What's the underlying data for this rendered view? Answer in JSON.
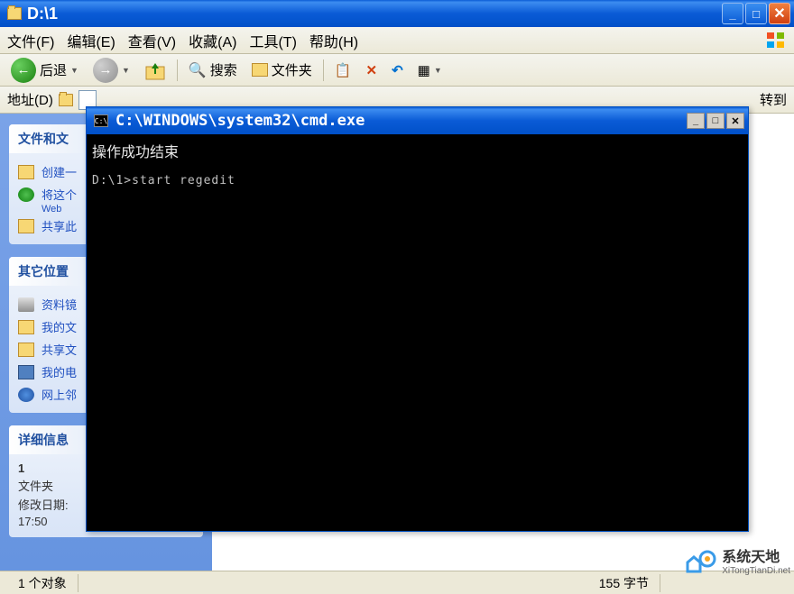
{
  "explorer": {
    "title": "D:\\1",
    "menu": {
      "file": "文件(F)",
      "edit": "编辑(E)",
      "view": "查看(V)",
      "favorites": "收藏(A)",
      "tools": "工具(T)",
      "help": "帮助(H)"
    },
    "toolbar": {
      "back": "后退",
      "search": "搜索",
      "folders": "文件夹"
    },
    "address": {
      "label": "地址(D)",
      "goto": "转到"
    },
    "sidebar": {
      "panel1": {
        "title": "文件和文",
        "items": [
          "创建一",
          "将这个",
          "共享此"
        ],
        "subweb": "Web"
      },
      "panel2": {
        "title": "其它位置",
        "items": [
          "资料镜",
          "我的文",
          "共享文",
          "我的电",
          "网上邻"
        ]
      },
      "panel3": {
        "title": "详细信息",
        "name": "1",
        "type": "文件夹",
        "modified_label": "修改日期:",
        "modified_time": "17:50"
      }
    },
    "statusbar": {
      "objects": "1 个对象",
      "size": "155 字节"
    }
  },
  "cmd": {
    "title": "C:\\WINDOWS\\system32\\cmd.exe",
    "icon_text": "C:\\",
    "line1": "操作成功结束",
    "prompt": "D:\\1>start regedit"
  },
  "watermark": {
    "brand": "系统天地",
    "url": "XiTongTianDi.net"
  }
}
